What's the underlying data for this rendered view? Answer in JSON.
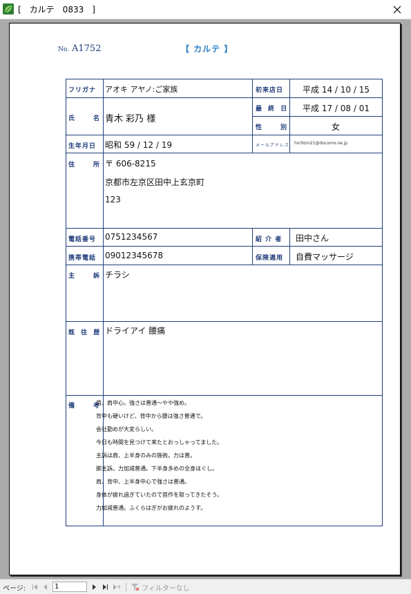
{
  "window": {
    "title": "[　カルテ　0833　]"
  },
  "report": {
    "no_label": "No.",
    "no_value": "A1752",
    "title": "【 カルテ 】"
  },
  "labels": {
    "furigana": "フリガナ",
    "name": "氏　　名",
    "birthdate": "生年月日",
    "address": "住　　所",
    "phone": "電話番号",
    "mobile": "携帯電話",
    "complaint": "主　　訴",
    "history": "既 往 歴",
    "notes": "備　　考",
    "first_visit": "初来店日",
    "last_visit": "最 終 日",
    "gender": "性　　別",
    "email": "メールアドレス",
    "referrer": "紹 介 者",
    "insurance": "保険適用"
  },
  "values": {
    "furigana": "アオキ アヤノ:ご家族",
    "name": "青木 彩乃 様",
    "birthdate": "昭和 59 / 12 / 19",
    "postal": "〒 606-8215",
    "address_line1": "京都市左京区田中上玄京町",
    "address_line2": "123",
    "phone": "0751234567",
    "mobile": "09012345678",
    "complaint": "チラシ",
    "history": "ドライアイ 腰痛",
    "first_visit": "平成 14 / 10 / 15",
    "last_visit": "平成 17 / 08 / 01",
    "gender": "女",
    "email": "hxr9zro21@docomo.ne.jp",
    "referrer": "田中さん",
    "insurance": "自費マッサージ"
  },
  "notes": [
    "首、肩中心。強さは普通〜やや強め。",
    "背中も硬いけど、背中から腰は強さ普通で。",
    "会社勤めが大変らしい。",
    "今日も時間を見つけて来たとおっしゃってました。",
    "主訴は肩、上半身のみの施術。力は普。",
    "脚主訴。力加減普通。下半身多めの全身ほぐし。",
    "肩、背中、上半身中心で強さは普通。",
    "身体が疲れ過ぎていたので首作を取ってきたそう。",
    "力加減普通。ふくらはぎがお疲れのようす。"
  ],
  "navbar": {
    "page_label": "ページ:",
    "page_value": "1",
    "filter_label": "フィルターなし"
  },
  "colors": {
    "label": "#1f3b7a",
    "title": "#2a7fc4"
  },
  "icons": [
    "app-leaf-icon",
    "close-icon",
    "first-page-icon",
    "prev-page-icon",
    "next-page-icon",
    "last-page-icon",
    "new-record-icon",
    "filter-icon"
  ]
}
